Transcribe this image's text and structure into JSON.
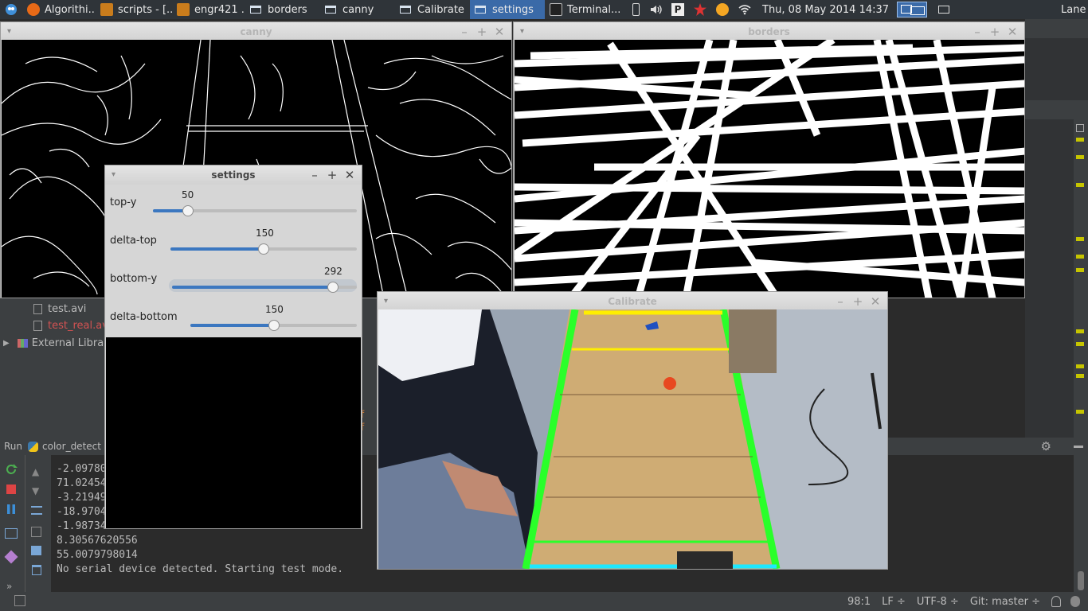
{
  "panel": {
    "tasks": [
      {
        "label": "Algorithi...",
        "icon": "firefox-icon",
        "color": "#e86a17"
      },
      {
        "label": "scripts - [...",
        "icon": "pycharm-icon",
        "color": "#c97c1c"
      },
      {
        "label": "engr421 ...",
        "icon": "pycharm-icon",
        "color": "#c97c1c"
      },
      {
        "label": "borders",
        "icon": "window-icon"
      },
      {
        "label": "canny",
        "icon": "window-icon"
      },
      {
        "label": "Calibrate",
        "icon": "window-icon"
      },
      {
        "label": "settings",
        "icon": "window-icon",
        "active": true
      },
      {
        "label": "Terminal...",
        "icon": "terminal-icon"
      }
    ],
    "clock": "Thu, 08 May 2014 14:37",
    "user": "Lane"
  },
  "canny": {
    "title": "canny"
  },
  "borders": {
    "title": "borders"
  },
  "calibrate": {
    "title": "Calibrate"
  },
  "settings": {
    "title": "settings",
    "trackbars": [
      {
        "label": "top-y",
        "value": "50",
        "fraction": 0.17
      },
      {
        "label": "delta-top",
        "value": "150",
        "fraction": 0.5
      },
      {
        "label": "bottom-y",
        "value": "292",
        "fraction": 0.87
      },
      {
        "label": "delta-bottom",
        "value": "150",
        "fraction": 0.5
      }
    ]
  },
  "project": {
    "files": [
      {
        "label": "test.avi",
        "color": "#bbbbbb"
      },
      {
        "label": "test_real.avi",
        "color": "#d25252"
      }
    ],
    "external": "External Libraries"
  },
  "run": {
    "label": "Run",
    "config": "color_detect"
  },
  "console": {
    "lines": [
      "-2.09780...",
      "71.02454...",
      "-3.21949...",
      "-18.9704...",
      "-1.98734...",
      "8.30567620556",
      "55.0079798014",
      "No serial device detected. Starting test mode."
    ]
  },
  "status": {
    "position": "98:1",
    "line_sep": "LF ÷",
    "encoding": "UTF-8 ÷",
    "vcs": "Git: master ÷"
  }
}
